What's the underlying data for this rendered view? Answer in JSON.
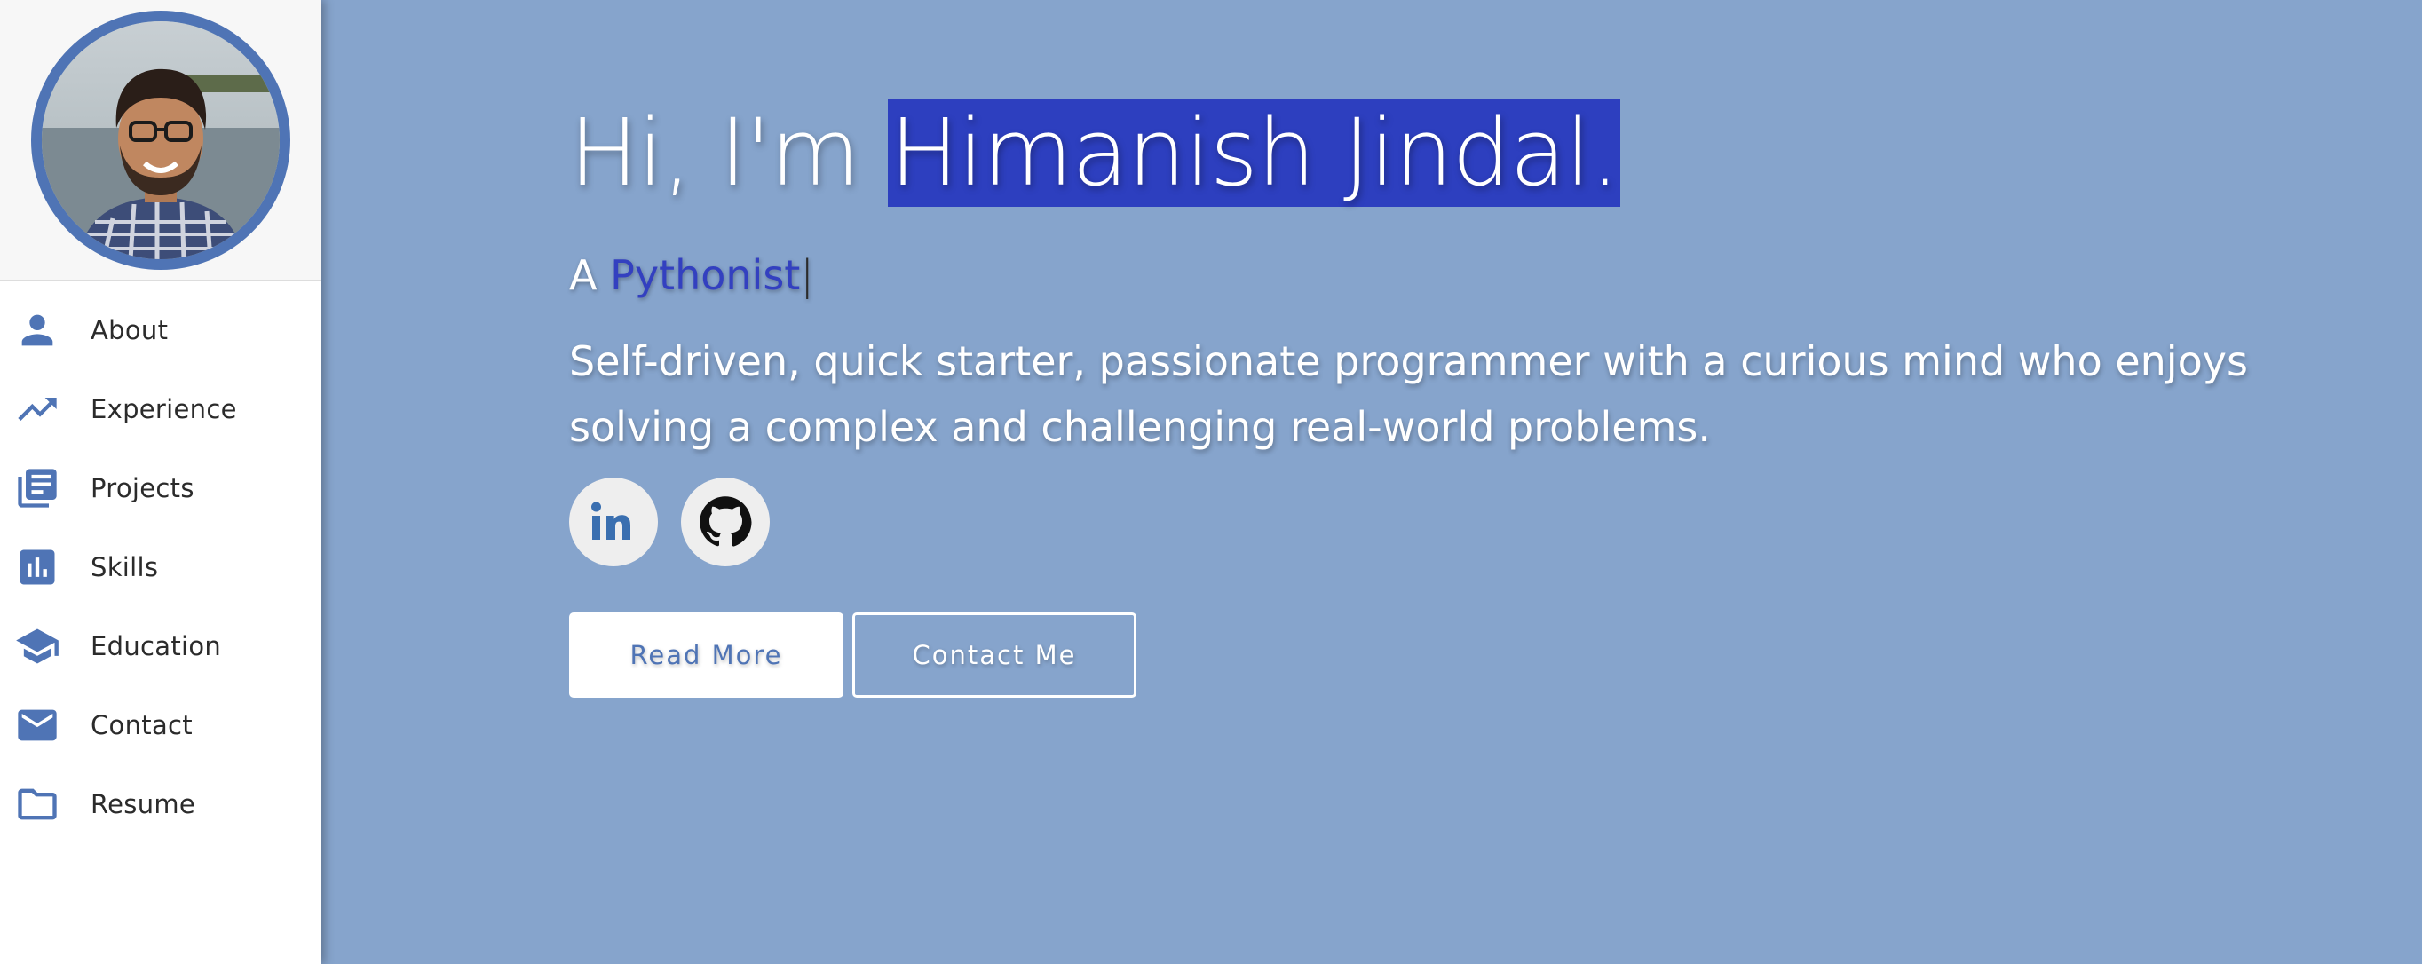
{
  "sidebar": {
    "avatar_alt": "profile photo",
    "items": [
      {
        "label": "About",
        "icon": "person-icon"
      },
      {
        "label": "Experience",
        "icon": "trending-up-icon"
      },
      {
        "label": "Projects",
        "icon": "library-books-icon"
      },
      {
        "label": "Skills",
        "icon": "bar-chart-icon"
      },
      {
        "label": "Education",
        "icon": "school-icon"
      },
      {
        "label": "Contact",
        "icon": "mail-icon"
      },
      {
        "label": "Resume",
        "icon": "folder-icon"
      }
    ]
  },
  "hero": {
    "greeting": "Hi, I'm ",
    "name": "Himanish Jindal.",
    "subtitle_prefix": "A ",
    "subtitle_role": "Pythonist",
    "subtitle_cursor": "|",
    "intro": "Self-driven, quick starter, passionate programmer with a curious mind who enjoys solving a complex and challenging real-world problems.",
    "socials": [
      {
        "name": "LinkedIn",
        "icon": "linkedin-icon"
      },
      {
        "name": "GitHub",
        "icon": "github-icon"
      }
    ],
    "read_more_label": "Read More",
    "contact_label": "Contact Me"
  },
  "colors": {
    "accent": "#4f74b5",
    "hero_background": "#86a4cc",
    "name_highlight": "#2d3fbf",
    "role_text": "#3340c0"
  }
}
